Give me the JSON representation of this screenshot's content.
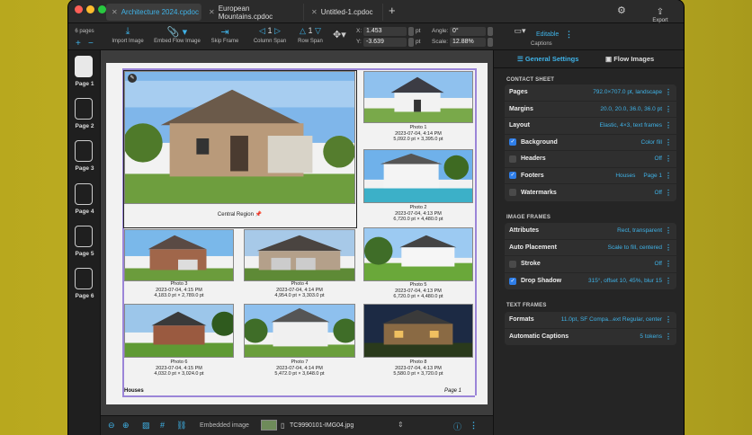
{
  "window": {
    "tabs": [
      {
        "label": "Architecture 2024.cpdoc",
        "active": true
      },
      {
        "label": "European Mountains.cpdoc",
        "active": false
      },
      {
        "label": "Untitled-1.cpdoc",
        "active": false
      }
    ],
    "export_label": "Export"
  },
  "toolbar": {
    "import_image": "Import Image",
    "embed_flow_image": "Embed Flow Image",
    "skip_frame": "Skip Frame",
    "column_span_value": "1",
    "column_span": "Column Span",
    "row_span_value": "1",
    "row_span": "Row Span",
    "x_label": "X:",
    "x_value": "1.453",
    "y_label": "Y:",
    "y_value": "-3.639",
    "unit": "pt",
    "angle_label": "Angle:",
    "angle_value": "0°",
    "scale_label": "Scale:",
    "scale_value": "12.88%",
    "editable": "Editable",
    "captions": "Captions"
  },
  "sidebar": {
    "page_count": "6 pages",
    "pages": [
      "Page 1",
      "Page 2",
      "Page 3",
      "Page 4",
      "Page 5",
      "Page 6"
    ]
  },
  "page": {
    "main_caption": "Central Region 📌",
    "photos": [
      {
        "title": "Photo 1",
        "date": "2023-07-04, 4:14 PM",
        "size": "5,092.0 pt × 3,395.0 pt"
      },
      {
        "title": "Photo 2",
        "date": "2023-07-04, 4:13 PM",
        "size": "6,720.0 pt × 4,480.0 pt"
      },
      {
        "title": "Photo 3",
        "date": "2023-07-04, 4:15 PM",
        "size": "4,183.0 pt × 2,789.0 pt"
      },
      {
        "title": "Photo 4",
        "date": "2023-07-04, 4:14 PM",
        "size": "4,954.0 pt × 3,303.0 pt"
      },
      {
        "title": "Photo 5",
        "date": "2023-07-04, 4:13 PM",
        "size": "6,720.0 pt × 4,480.0 pt"
      },
      {
        "title": "Photo 6",
        "date": "2023-07-04, 4:15 PM",
        "size": "4,032.0 pt × 3,024.0 pt"
      },
      {
        "title": "Photo 7",
        "date": "2023-07-04, 4:14 PM",
        "size": "5,472.0 pt × 3,648.0 pt"
      },
      {
        "title": "Photo 8",
        "date": "2023-07-04, 4:13 PM",
        "size": "5,580.0 pt × 3,720.0 pt"
      }
    ],
    "footer_left": "Houses",
    "footer_right": "Page 1"
  },
  "panel": {
    "tab_general": "General Settings",
    "tab_flow": "Flow Images",
    "contact_sheet_header": "CONTACT SHEET",
    "contact_sheet": [
      {
        "label": "Pages",
        "value": "792.0×707.0 pt, landscape"
      },
      {
        "label": "Margins",
        "value": "20.0, 20.0, 36.0, 36.0 pt"
      },
      {
        "label": "Layout",
        "value": "Elastic, 4×3, text frames"
      },
      {
        "label": "Background",
        "value": "Color fill",
        "checked": true
      },
      {
        "label": "Headers",
        "value": "Off",
        "checked": false
      },
      {
        "label": "Footers",
        "value": "Houses     Page 1",
        "checked": true
      },
      {
        "label": "Watermarks",
        "value": "Off",
        "checked": false
      }
    ],
    "image_frames_header": "IMAGE FRAMES",
    "image_frames": [
      {
        "label": "Attributes",
        "value": "Rect, transparent"
      },
      {
        "label": "Auto Placement",
        "value": "Scale to fill, centered"
      },
      {
        "label": "Stroke",
        "value": "Off",
        "checked": false
      },
      {
        "label": "Drop Shadow",
        "value": "315°, offset 10, 45%, blur 15",
        "checked": true
      }
    ],
    "text_frames_header": "TEXT FRAMES",
    "text_frames": [
      {
        "label": "Formats",
        "value": "11.0pt, SF Compa...ext Regular, center"
      },
      {
        "label": "Automatic Captions",
        "value": "5 tokens"
      }
    ]
  },
  "bottombar": {
    "embedded_image": "Embedded image",
    "filename": "TC9990101-IMG04.jpg"
  },
  "colors": {
    "accent": "#3fb3e8",
    "checkbox": "#2f7ee8",
    "margin_guide": "#9b85d8"
  }
}
